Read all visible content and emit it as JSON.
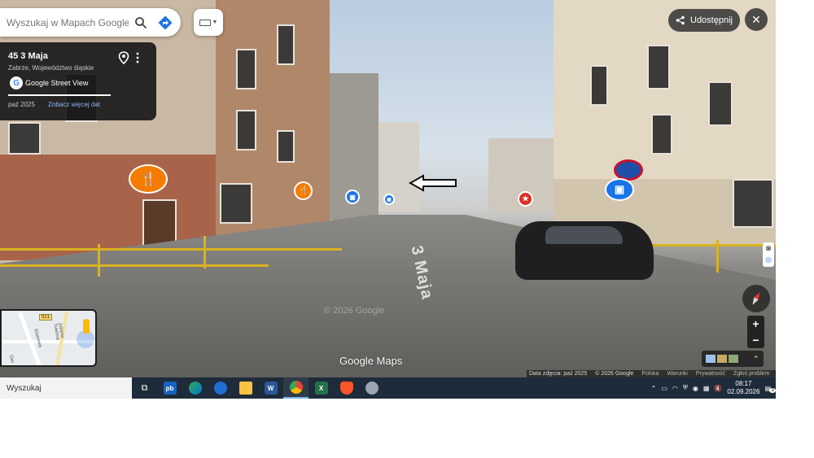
{
  "search": {
    "placeholder": "Wyszukaj w Mapach Google"
  },
  "info_card": {
    "title": "45 3 Maja",
    "subtitle": "Zabrze, Województwo śląskie",
    "source_label": "Google Street View",
    "date_label": "paź 2025",
    "more_dates_label": "Zobacz więcej dat"
  },
  "top_right": {
    "share_label": "Udostępnij"
  },
  "minimap": {
    "badge": "921",
    "streets": [
      "Klonowa",
      "Juliana Tuwima",
      "Ger"
    ]
  },
  "scene": {
    "road_marking": "3 Maja",
    "watermark": "© 2026 Google",
    "logo": "Google Maps"
  },
  "attribution": {
    "capture_date": "Data zdjęcia: paź 2025",
    "copyright": "© 2026 Google",
    "links": [
      "Polska",
      "Warunki",
      "Prywatność",
      "Zgłoś problem"
    ]
  },
  "zoom": {
    "in": "+",
    "out": "−"
  },
  "taskbar": {
    "search_label": "Wyszukaj",
    "apps": [
      "task-view",
      "pb",
      "edge",
      "thunderbird",
      "file-explorer",
      "word",
      "chrome",
      "excel",
      "brave",
      "app"
    ],
    "clock_time": "08:17",
    "clock_date": "02.09.2026",
    "notification_count": "3"
  },
  "colors": {
    "poi_food": "#f57c00",
    "poi_shop": "#1a73e8",
    "poi_red": "#d93025",
    "taskbar": "#1d2b3a"
  }
}
